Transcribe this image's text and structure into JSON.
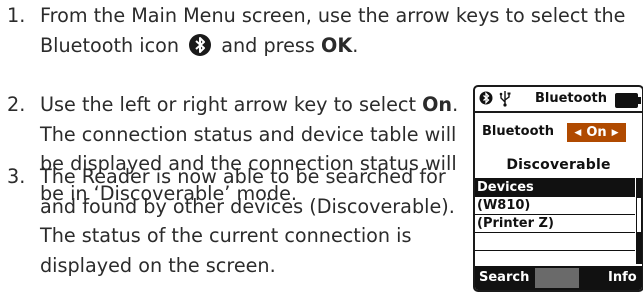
{
  "steps": [
    {
      "number": "1.",
      "line1_a": "From the Main Menu screen, use the arrow keys to select the",
      "line2_a": "Bluetooth icon",
      "line2_b": "and press",
      "line2_bold": "OK",
      "line2_end": "."
    },
    {
      "number": "2.",
      "line1_a": "Use the left or right arrow key to select",
      "line1_bold": "On",
      "line1_end": ".",
      "line2": "The connection status and device table will",
      "line3": "be displayed and the connection status will",
      "line4": "be in ‘Discoverable’ mode."
    },
    {
      "number": "3.",
      "line1": "The Reader is now able to be searched for",
      "line2": "and found by other devices (Discoverable).",
      "line3": "The status of the current connection is",
      "line4": "displayed on the screen."
    }
  ],
  "device": {
    "title": "Bluetooth",
    "row_label": "Bluetooth",
    "toggle_value": "On",
    "status": "Discoverable",
    "table_header": "Devices",
    "rows": [
      "(W810)",
      "(Printer Z)",
      "",
      ""
    ],
    "softkey_left": "Search",
    "softkey_right": "Info",
    "icons": {
      "status_left": "bluetooth-small-icon",
      "status_usb": "usb-icon",
      "battery": "battery-icon"
    },
    "accent_color": "#b04a00"
  }
}
